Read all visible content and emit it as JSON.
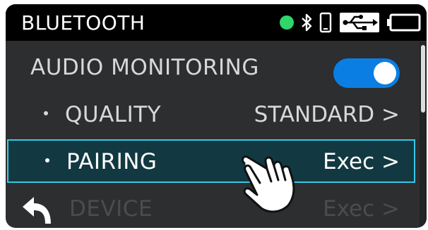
{
  "header": {
    "title": "BLUETOOTH"
  },
  "menu": {
    "audio_monitoring": {
      "label": "AUDIO MONITORING",
      "enabled": true
    },
    "quality": {
      "label": "QUALITY",
      "value": "STANDARD >"
    },
    "pairing": {
      "label": "PAIRING",
      "value": "Exec >"
    },
    "device": {
      "label": "DEVICE",
      "value": "Exec >"
    }
  },
  "colors": {
    "status_dot": "#2fd66a",
    "toggle_on": "#0b7ee3",
    "selection_border": "#39c7e6",
    "selection_fill": "#123941"
  },
  "icons": [
    "status-dot-icon",
    "bluetooth-icon",
    "phone-icon",
    "usb-icon",
    "battery-icon",
    "back-arrow-icon",
    "tap-hand-icon"
  ]
}
